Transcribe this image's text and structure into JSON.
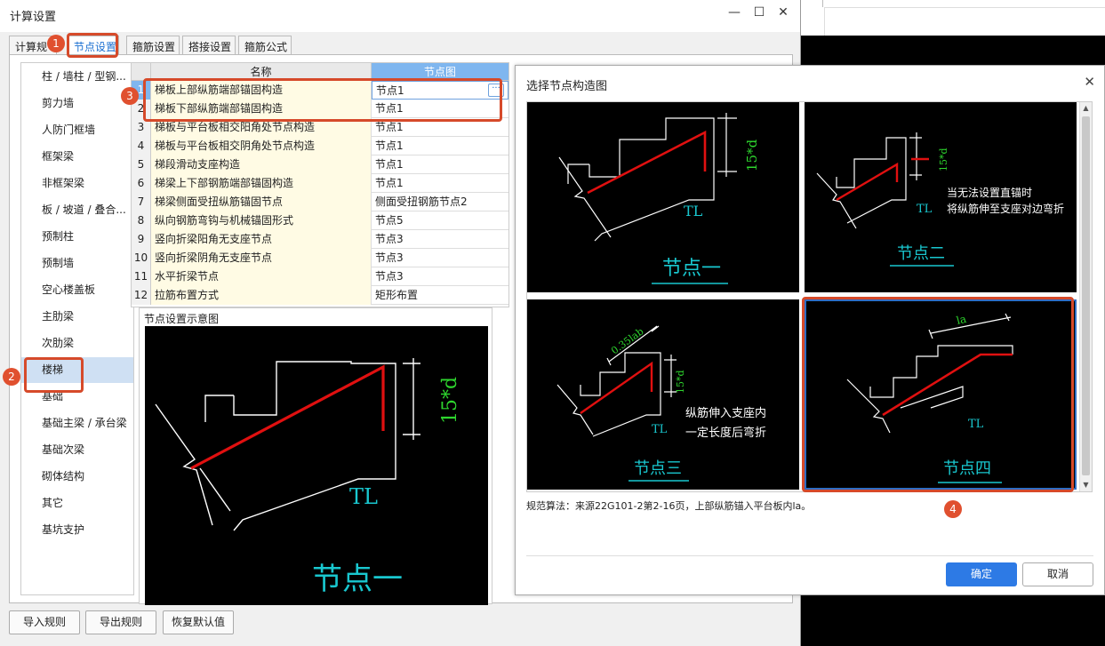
{
  "main_window": {
    "title": "计算设置",
    "minimize": "—",
    "maximize": "☐",
    "close": "✕"
  },
  "tabs": [
    {
      "label": "计算规",
      "active": false
    },
    {
      "label": "节点设置",
      "active": true
    },
    {
      "label": "箍筋设置",
      "active": false
    },
    {
      "label": "搭接设置",
      "active": false
    },
    {
      "label": "箍筋公式",
      "active": false
    }
  ],
  "sidebar": {
    "items": [
      "柱 / 墙柱 / 型钢...",
      "剪力墙",
      "人防门框墙",
      "框架梁",
      "非框架梁",
      "板 / 坡道 / 叠合...",
      "预制柱",
      "预制墙",
      "空心楼盖板",
      "主肋梁",
      "次肋梁",
      "楼梯",
      "基础",
      "基础主梁 / 承台梁",
      "基础次梁",
      "砌体结构",
      "其它",
      "基坑支护"
    ],
    "selected_index": 11
  },
  "grid": {
    "headers": {
      "name": "名称",
      "value": "节点图"
    },
    "rows": [
      {
        "no": "1",
        "name": "梯板上部纵筋端部锚固构造",
        "value": "节点1"
      },
      {
        "no": "2",
        "name": "梯板下部纵筋端部锚固构造",
        "value": "节点1"
      },
      {
        "no": "3",
        "name": "梯板与平台板相交阳角处节点构造",
        "value": "节点1"
      },
      {
        "no": "4",
        "name": "梯板与平台板相交阴角处节点构造",
        "value": "节点1"
      },
      {
        "no": "5",
        "name": "梯段滑动支座构造",
        "value": "节点1"
      },
      {
        "no": "6",
        "name": "梯梁上下部钢筋端部锚固构造",
        "value": "节点1"
      },
      {
        "no": "7",
        "name": "梯梁侧面受扭纵筋锚固节点",
        "value": "侧面受扭钢筋节点2"
      },
      {
        "no": "8",
        "name": "纵向钢筋弯钩与机械锚固形式",
        "value": "节点5"
      },
      {
        "no": "9",
        "name": "竖向折梁阳角无支座节点",
        "value": "节点3"
      },
      {
        "no": "10",
        "name": "竖向折梁阴角无支座节点",
        "value": "节点3"
      },
      {
        "no": "11",
        "name": "水平折梁节点",
        "value": "节点3"
      },
      {
        "no": "12",
        "name": "拉筋布置方式",
        "value": "矩形布置"
      }
    ],
    "ellipsis": "···"
  },
  "preview": {
    "label": "节点设置示意图",
    "caption": "节点一",
    "beam_label": "TL",
    "dim_label": "15*d"
  },
  "bottom_buttons": {
    "import": "导入规则",
    "export": "导出规则",
    "restore": "恢复默认值"
  },
  "dialog": {
    "title": "选择节点构造图",
    "close": "✕",
    "nodes": [
      {
        "caption": "节点一",
        "beam": "TL",
        "dim": "15*d",
        "note_lines": []
      },
      {
        "caption": "节点二",
        "beam": "TL",
        "dim": "15*d",
        "note_lines": [
          "当无法设置直锚时",
          "将纵筋伸至支座对边弯折"
        ]
      },
      {
        "caption": "节点三",
        "beam": "TL",
        "dim": "15*d",
        "dim2": "0.35lab",
        "note_lines": [
          "纵筋伸入支座内",
          "一定长度后弯折"
        ]
      },
      {
        "caption": "节点四",
        "beam": "TL",
        "dim": "la",
        "note_lines": []
      }
    ],
    "selected_index": 3,
    "note": "规范算法：来源22G101-2第2-16页，上部纵筋锚入平台板内la。",
    "ok": "确定",
    "cancel": "取消"
  },
  "annotations": [
    "1",
    "2",
    "3",
    "4"
  ],
  "colors": {
    "accent": "#2d7ae5",
    "annotation": "#d64a2a",
    "rebar": "#e01010",
    "dimension": "#2ed62e",
    "caption": "#19c7cf"
  }
}
